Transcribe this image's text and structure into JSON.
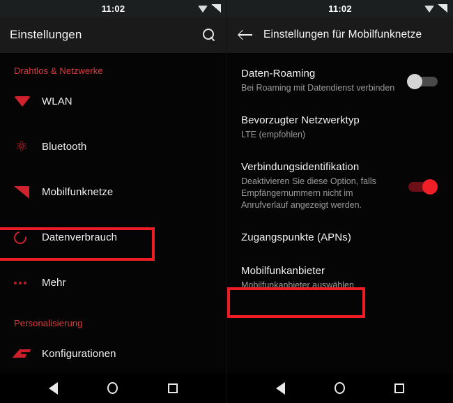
{
  "statusbar": {
    "time": "11:02",
    "icons": [
      "wifi-icon",
      "signal-icon"
    ]
  },
  "left_panel": {
    "appbar": {
      "title": "Einstellungen",
      "search_icon": "search-icon"
    },
    "sections": [
      {
        "header": "Drahtlos & Netzwerke",
        "items": [
          {
            "label": "WLAN",
            "icon": "wifi-icon",
            "highlighted": false
          },
          {
            "label": "Bluetooth",
            "icon": "bluetooth-icon",
            "highlighted": false
          },
          {
            "label": "Mobilfunknetze",
            "icon": "cellular-icon",
            "highlighted": true
          },
          {
            "label": "Datenverbrauch",
            "icon": "data-usage-icon",
            "highlighted": false
          },
          {
            "label": "Mehr",
            "icon": "more-dots-icon",
            "highlighted": false
          }
        ]
      },
      {
        "header": "Personalisierung",
        "items": [
          {
            "label": "Konfigurationen",
            "icon": "configurations-icon",
            "highlighted": false
          }
        ]
      }
    ]
  },
  "right_panel": {
    "appbar": {
      "back_icon": "back-arrow-icon",
      "title": "Einstellungen für Mobilfunknetze"
    },
    "items": [
      {
        "title": "Daten-Roaming",
        "subtitle": "Bei Roaming mit Datendienst verbinden",
        "control": "toggle",
        "toggle_state": "off",
        "highlighted": false
      },
      {
        "title": "Bevorzugter Netzwerktyp",
        "subtitle": "LTE (empfohlen)",
        "control": "none",
        "highlighted": false
      },
      {
        "title": "Verbindungsidentifikation",
        "subtitle": "Deaktivieren Sie diese Option, falls Empfängernummern nicht im Anrufverlauf angezeigt werden.",
        "control": "toggle",
        "toggle_state": "on",
        "highlighted": false
      },
      {
        "title": "Zugangspunkte (APNs)",
        "subtitle": "",
        "control": "none",
        "highlighted": true
      },
      {
        "title": "Mobilfunkanbieter",
        "subtitle": "Mobilfunkanbieter auswählen",
        "control": "none",
        "highlighted": false
      }
    ]
  },
  "navbar": {
    "back": "back-triangle-icon",
    "home": "home-circle-icon",
    "recents": "recents-square-icon"
  },
  "colors": {
    "accent_red": "#d0222c",
    "highlight_red": "#ee1c25",
    "toggle_on": "#f01f28",
    "background": "#050505",
    "appbar": "#1a1a1a",
    "statusbar": "#1b1f20",
    "teal_line": "#1d6b6e"
  }
}
